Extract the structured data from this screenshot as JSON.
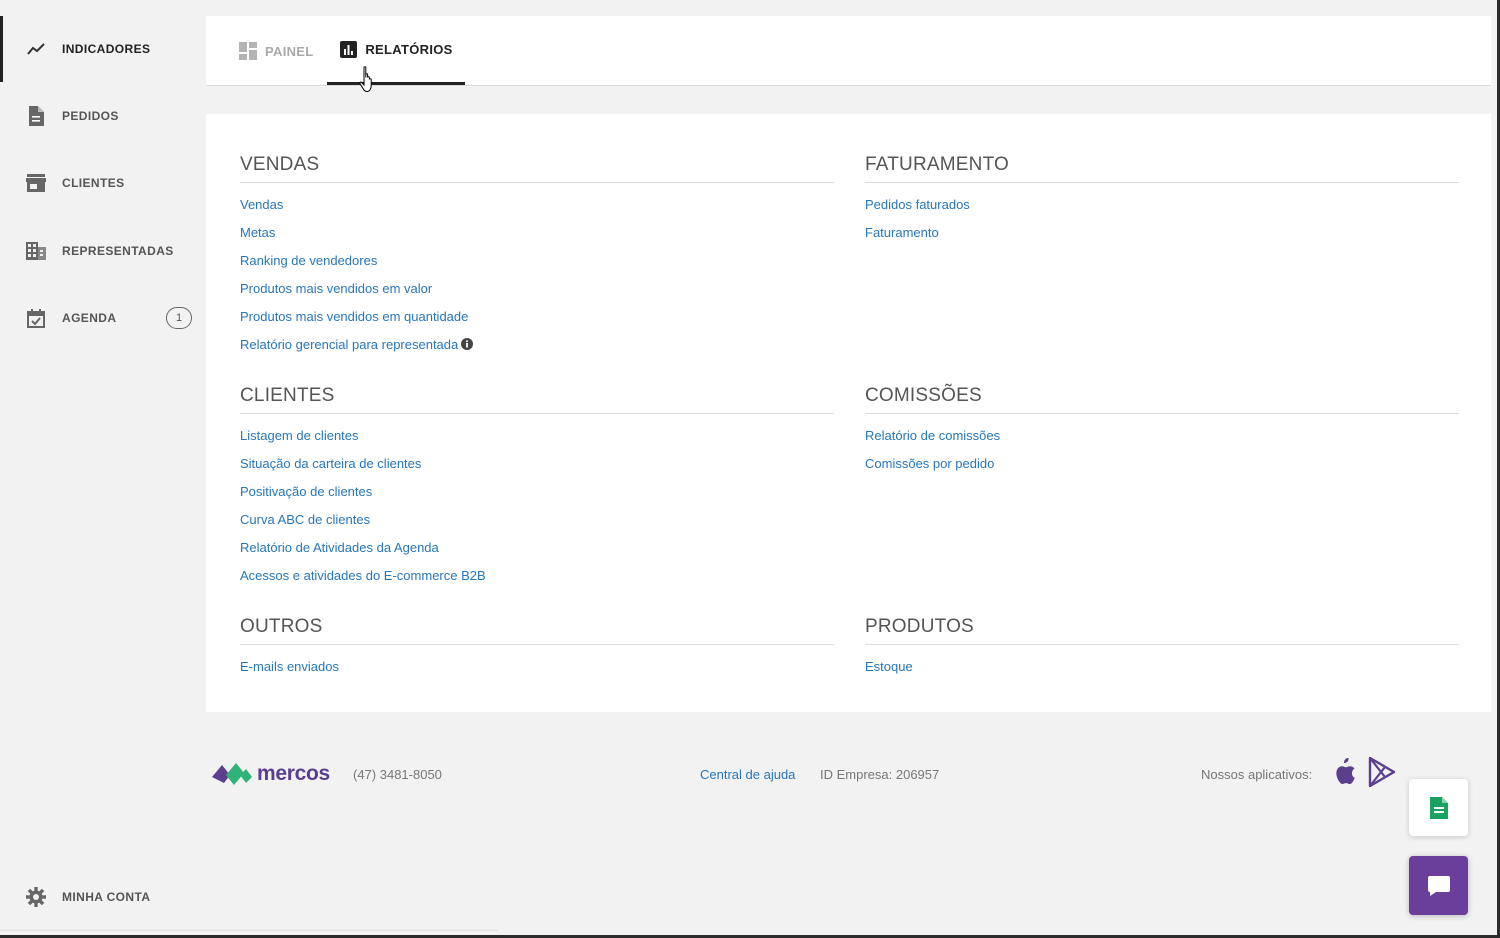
{
  "sidebar": {
    "items": [
      {
        "label": "INDICADORES",
        "icon": "trending-icon",
        "active": true
      },
      {
        "label": "PEDIDOS",
        "icon": "document-icon"
      },
      {
        "label": "CLIENTES",
        "icon": "store-icon"
      },
      {
        "label": "REPRESENTADAS",
        "icon": "building-icon"
      },
      {
        "label": "AGENDA",
        "icon": "calendar-check-icon",
        "badge": "1"
      }
    ],
    "account": {
      "label": "MINHA CONTA",
      "icon": "gear-icon"
    }
  },
  "tabs": [
    {
      "label": "PAINEL",
      "icon": "dashboard-icon",
      "active": false
    },
    {
      "label": "RELATÓRIOS",
      "icon": "report-icon",
      "active": true
    }
  ],
  "sections": {
    "vendas": {
      "title": "VENDAS",
      "links": [
        "Vendas",
        "Metas",
        "Ranking de vendedores",
        "Produtos mais vendidos em valor",
        "Produtos mais vendidos em quantidade",
        "Relatório gerencial para representada"
      ]
    },
    "faturamento": {
      "title": "FATURAMENTO",
      "links": [
        "Pedidos faturados",
        "Faturamento"
      ]
    },
    "clientes": {
      "title": "CLIENTES",
      "links": [
        "Listagem de clientes",
        "Situação da carteira de clientes",
        "Positivação de clientes",
        "Curva ABC de clientes",
        "Relatório de Atividades da Agenda",
        "Acessos e atividades do E-commerce B2B"
      ]
    },
    "comissoes": {
      "title": "COMISSÕES",
      "links": [
        "Relatório de comissões",
        "Comissões por pedido"
      ]
    },
    "outros": {
      "title": "OUTROS",
      "links": [
        "E-mails enviados"
      ]
    },
    "produtos": {
      "title": "PRODUTOS",
      "links": [
        "Estoque"
      ]
    }
  },
  "footer": {
    "brand": "mercos",
    "phone": "(47) 3481-8050",
    "help_link": "Central de ajuda",
    "company_id": "ID Empresa: 206957",
    "apps_label": "Nossos aplicativos:"
  },
  "colors": {
    "link": "#2777b9",
    "brand_purple": "#5b3f8f",
    "brand_green": "#2fb379",
    "chat_button": "#6a3f9c",
    "sheet_icon": "#1aa260"
  }
}
